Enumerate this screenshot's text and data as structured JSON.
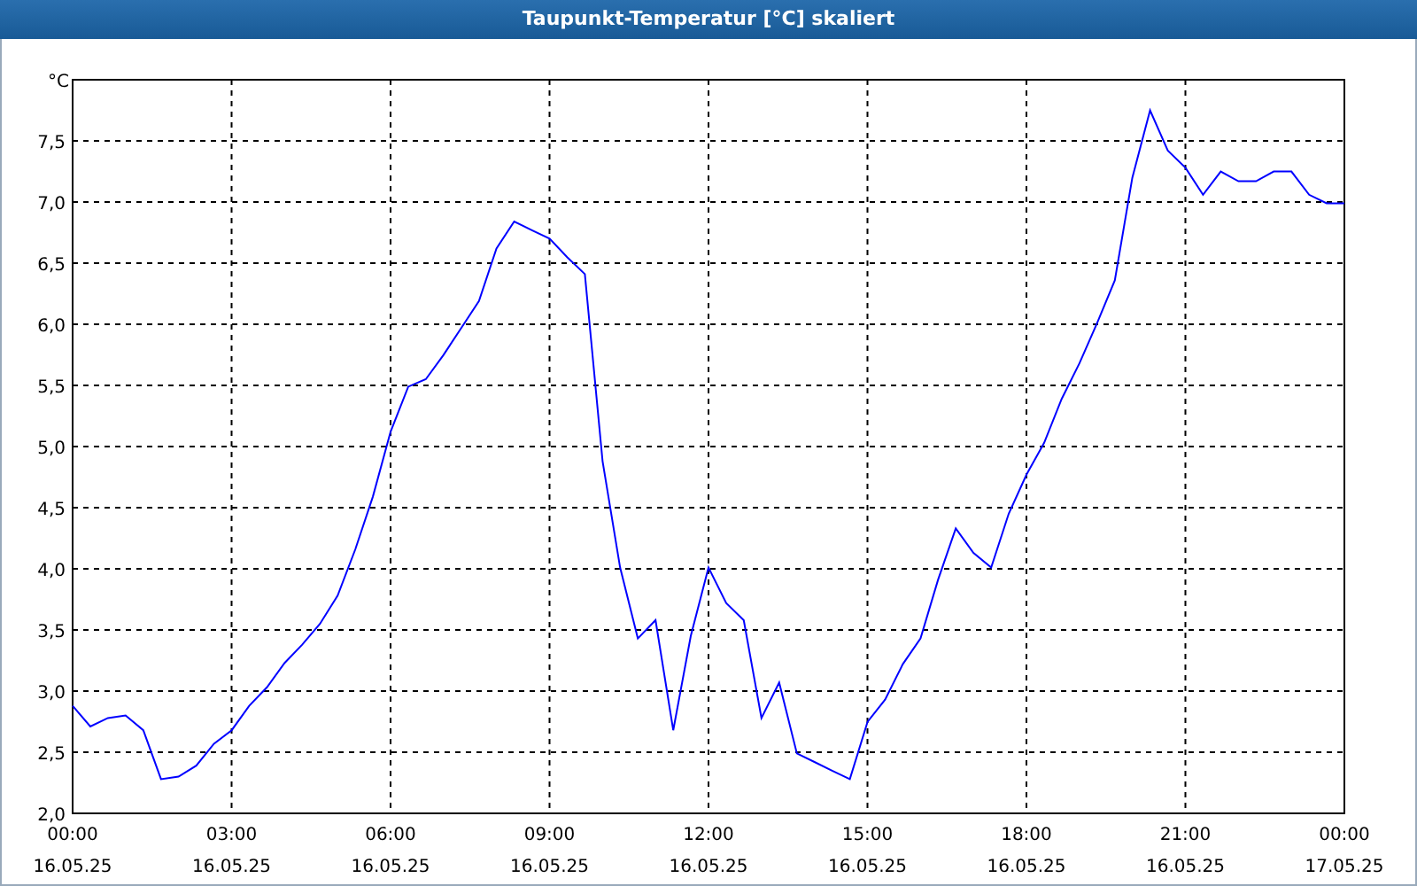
{
  "window": {
    "title": "Taupunkt-Temperatur [°C] skaliert"
  },
  "chart_data": {
    "type": "line",
    "ylabel": "°C",
    "grid": true,
    "ylim": [
      2.0,
      8.0
    ],
    "categories": [
      "00:00\n16.05.25",
      null,
      null,
      null,
      null,
      null,
      null,
      null,
      null,
      "03:00\n16.05.25",
      null,
      null,
      null,
      null,
      null,
      null,
      null,
      null,
      "06:00\n16.05.25",
      null,
      null,
      null,
      null,
      null,
      null,
      null,
      null,
      "09:00\n16.05.25",
      null,
      null,
      null,
      null,
      null,
      null,
      null,
      null,
      "12:00\n16.05.25",
      null,
      null,
      null,
      null,
      null,
      null,
      null,
      null,
      "15:00\n16.05.25",
      null,
      null,
      null,
      null,
      null,
      null,
      null,
      null,
      "18:00\n16.05.25",
      null,
      null,
      null,
      null,
      null,
      null,
      null,
      null,
      "21:00\n16.05.25",
      null,
      null,
      null,
      null,
      null,
      null,
      null,
      null,
      "00:00\n17.05.25"
    ],
    "series": [
      {
        "color": "#0000ff",
        "values": [
          2.88,
          2.71,
          2.78,
          2.8,
          2.68,
          2.28,
          2.3,
          2.39,
          2.57,
          2.68,
          2.88,
          3.03,
          3.23,
          3.38,
          3.55,
          3.78,
          4.16,
          4.59,
          5.12,
          5.49,
          5.55,
          5.75,
          5.97,
          6.19,
          6.62,
          6.84,
          6.77,
          6.7,
          6.55,
          6.41,
          4.88,
          4.01,
          3.43,
          3.58,
          2.68,
          3.45,
          4.01,
          3.72,
          3.58,
          2.78,
          3.07,
          2.49,
          2.42,
          2.35,
          2.28,
          2.75,
          2.93,
          3.22,
          3.43,
          3.91,
          4.33,
          4.13,
          4.01,
          4.45,
          4.77,
          5.03,
          5.39,
          5.68,
          6.01,
          6.36,
          7.2,
          7.75,
          7.42,
          7.28,
          7.06,
          7.25,
          7.17,
          7.17,
          7.25,
          7.25,
          7.06,
          6.99,
          6.99
        ]
      }
    ],
    "yticks": [
      {
        "value": 2.0,
        "label": "2,0"
      },
      {
        "value": 2.5,
        "label": "2,5"
      },
      {
        "value": 3.0,
        "label": "3,0"
      },
      {
        "value": 3.5,
        "label": "3,5"
      },
      {
        "value": 4.0,
        "label": "4,0"
      },
      {
        "value": 4.5,
        "label": "4,5"
      },
      {
        "value": 5.0,
        "label": "5,0"
      },
      {
        "value": 5.5,
        "label": "5,5"
      },
      {
        "value": 6.0,
        "label": "6,0"
      },
      {
        "value": 6.5,
        "label": "6,5"
      },
      {
        "value": 7.0,
        "label": "7,0"
      },
      {
        "value": 7.5,
        "label": "7,5"
      },
      {
        "value": 8.0,
        "label": null
      }
    ]
  }
}
